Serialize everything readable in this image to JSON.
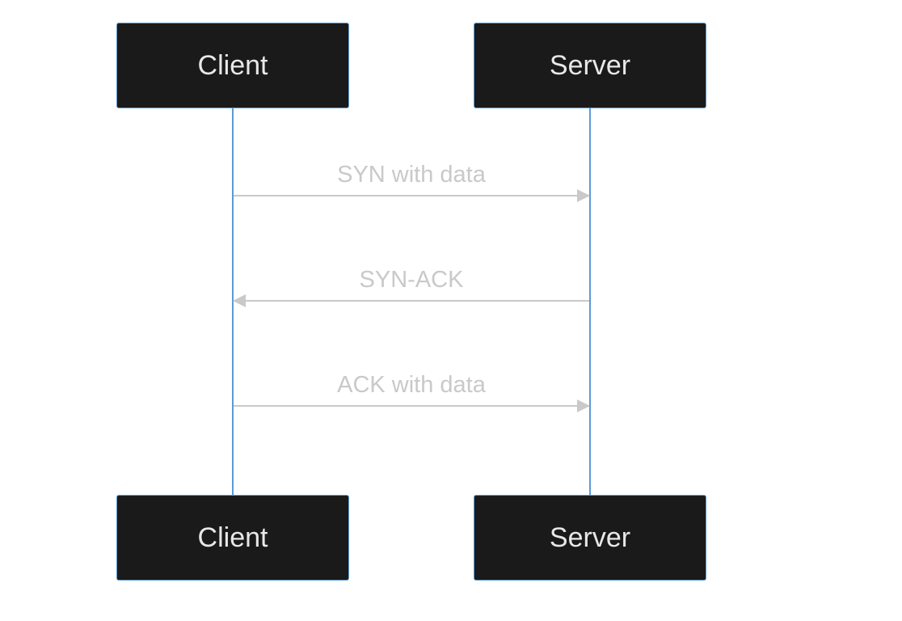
{
  "diagram": {
    "type": "sequence",
    "participants": {
      "left": "Client",
      "right": "Server"
    },
    "participants_bottom": {
      "left": "Client",
      "right": "Server"
    },
    "messages": [
      {
        "label": "SYN with data",
        "from": "Client",
        "to": "Server",
        "direction": "right"
      },
      {
        "label": "SYN-ACK",
        "from": "Server",
        "to": "Client",
        "direction": "left"
      },
      {
        "label": "ACK with data",
        "from": "Client",
        "to": "Server",
        "direction": "right"
      }
    ],
    "colors": {
      "node_fill": "#1a1a1a",
      "node_border": "#5b9bd5",
      "node_text": "#e8e8e8",
      "lifeline": "#5b9bd5",
      "arrow": "#c9c9c9",
      "label_text": "#c9c9c9"
    }
  }
}
